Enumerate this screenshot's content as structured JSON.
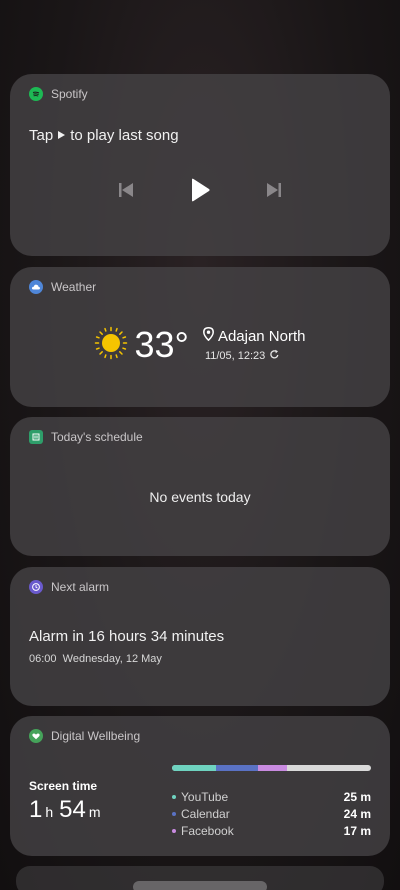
{
  "spotify": {
    "app_name": "Spotify",
    "prompt_before": "Tap",
    "prompt_after": "to play last song"
  },
  "weather": {
    "app_name": "Weather",
    "temperature": "33°",
    "location": "Adajan North",
    "updated": "11/05, 12:23"
  },
  "schedule": {
    "app_name": "Today's schedule",
    "message": "No events today"
  },
  "alarm": {
    "app_name": "Next alarm",
    "main": "Alarm in 16 hours 34 minutes",
    "time": "06:00",
    "date": "Wednesday, 12 May"
  },
  "wellbeing": {
    "app_name": "Digital Wellbeing",
    "screen_time_label": "Screen time",
    "hours": "1",
    "hours_unit": "h",
    "minutes": "54",
    "minutes_unit": "m",
    "apps": [
      {
        "name": "YouTube",
        "time": "25 m",
        "color": "#6fd3c0"
      },
      {
        "name": "Calendar",
        "time": "24 m",
        "color": "#5a72c4"
      },
      {
        "name": "Facebook",
        "time": "17 m",
        "color": "#c98be0"
      }
    ]
  },
  "colors": {
    "spotify_green": "#1db954",
    "weather_blue": "#4f86d8",
    "schedule_green": "#2e9e6a",
    "alarm_purple": "#6a5acd",
    "wellbeing_green": "#45a35a",
    "sun_yellow": "#f5c400"
  },
  "icons": {
    "spotify": "spotify-logo-icon",
    "weather": "cloud-icon",
    "schedule": "calendar-icon",
    "alarm": "clock-icon",
    "wellbeing": "heart-icon",
    "play": "play-icon",
    "previous": "previous-track-icon",
    "next": "next-track-icon",
    "sun": "sun-icon",
    "location": "location-pin-icon",
    "refresh": "refresh-icon"
  }
}
